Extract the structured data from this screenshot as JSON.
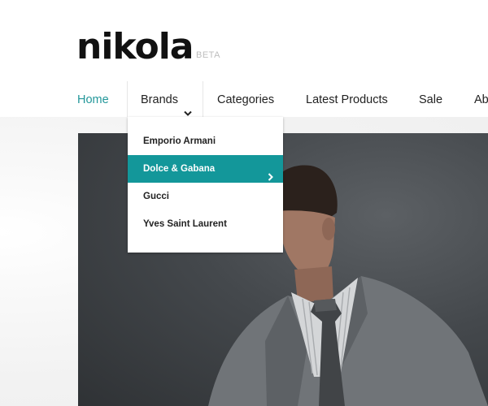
{
  "brand": {
    "name": "nikola",
    "tag": "BETA"
  },
  "nav": {
    "items": [
      {
        "label": "Home"
      },
      {
        "label": "Brands"
      },
      {
        "label": "Categories"
      },
      {
        "label": "Latest Products"
      },
      {
        "label": "Sale"
      },
      {
        "label": "Ab"
      }
    ],
    "active": "Home",
    "open_menu": "Brands"
  },
  "brands_menu": {
    "items": [
      {
        "label": "Emporio Armani"
      },
      {
        "label": "Dolce & Gabana"
      },
      {
        "label": "Gucci"
      },
      {
        "label": "Yves Saint Laurent"
      }
    ],
    "highlighted": "Dolce & Gabana"
  },
  "colors": {
    "accent": "#13979a",
    "active_link": "#23979a",
    "text": "#222222"
  },
  "icons": [
    "chevron-down-icon",
    "chevron-right-icon"
  ]
}
